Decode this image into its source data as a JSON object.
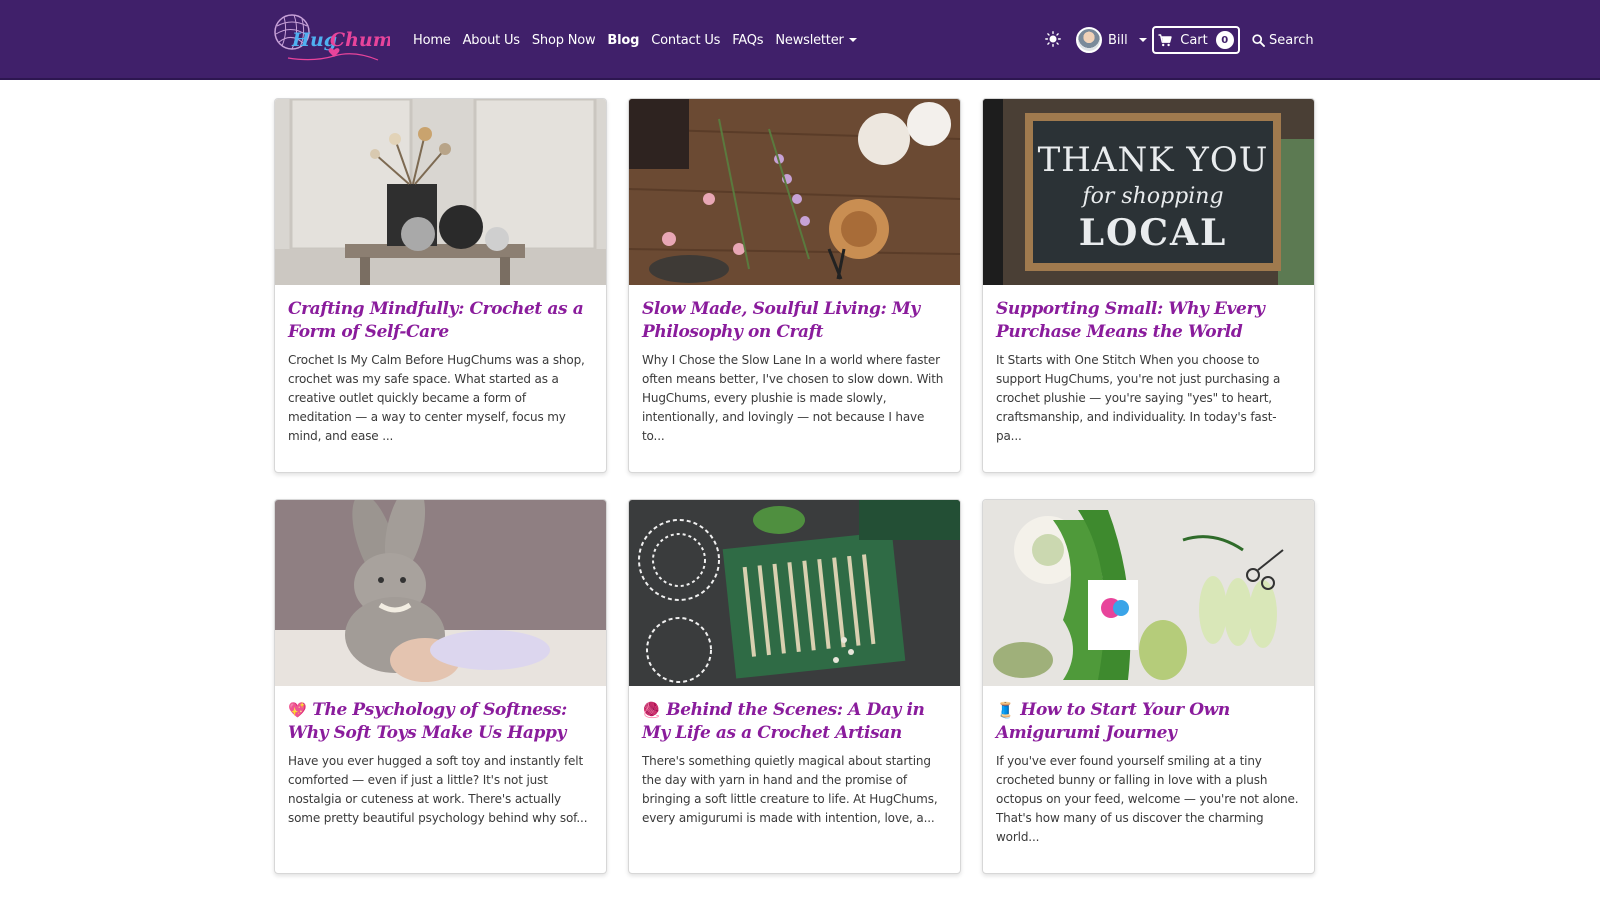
{
  "brand": {
    "logo_text": "Hug Chums",
    "colors": {
      "navbar": "#40206a",
      "title_purple": "#8a1c9c",
      "logo_pink": "#e8449b",
      "logo_blue": "#3aa4e8"
    }
  },
  "nav": {
    "links": [
      {
        "label": "Home"
      },
      {
        "label": "About Us"
      },
      {
        "label": "Shop Now"
      },
      {
        "label": "Blog",
        "active": true
      },
      {
        "label": "Contact Us"
      },
      {
        "label": "FAQs"
      },
      {
        "label": "Newsletter"
      }
    ],
    "theme_icon": "sun-icon",
    "user_name": "Bill",
    "cart_label": "Cart",
    "cart_count": "0",
    "search_label": "Search"
  },
  "posts": [
    {
      "image": "crochet-yarn-stool-photo",
      "title": "Crafting Mindfully: Crochet as a Form of Self-Care",
      "emoji": "",
      "excerpt": "Crochet Is My Calm Before HugChums was a shop, crochet was my safe space. What started as a creative outlet quickly became a form of meditation — a way to center myself, focus my mind, and ease ..."
    },
    {
      "image": "craft-table-flowers-photo",
      "title": "Slow Made, Soulful Living: My Philosophy on Craft",
      "emoji": "",
      "excerpt": "Why I Chose the Slow Lane In a world where faster often means better, I've chosen to slow down. With HugChums, every plushie is made slowly, intentionally, and lovingly — not because I have to..."
    },
    {
      "image": "thank-you-shop-local-chalkboard-photo",
      "title": "Supporting Small: Why Every Purchase Means the World",
      "emoji": "",
      "excerpt": "It Starts with One Stitch When you choose to support HugChums, you're not just purchasing a crochet plushie — you're saying \"yes\" to heart, craftsmanship, and individuality. In today's fast-pa..."
    },
    {
      "image": "baby-with-plush-bunny-photo",
      "title": "The Psychology of Softness: Why Soft Toys Make Us Happy",
      "emoji": "💖",
      "excerpt": "Have you ever hugged a soft toy and instantly felt comforted — even if just a little? It's not just nostalgia or cuteness at work. There's actually some pretty beautiful psychology behind why sof..."
    },
    {
      "image": "crochet-hook-set-doilies-photo",
      "title": "Behind the Scenes: A Day in My Life as a Crochet Artisan",
      "emoji": "🧶",
      "excerpt": "There's something quietly magical about starting the day with yarn in hand and the promise of bringing a soft little creature to life. At HugChums, every amigurumi is made with intention, love, a..."
    },
    {
      "image": "green-yarn-skeins-scissors-photo",
      "title": "How to Start Your Own Amigurumi Journey",
      "emoji": "🧵",
      "excerpt": "If you've ever found yourself smiling at a tiny crocheted bunny or falling in love with a plush octopus on your feed, welcome — you're not alone. That's how many of us discover the charming world..."
    }
  ]
}
